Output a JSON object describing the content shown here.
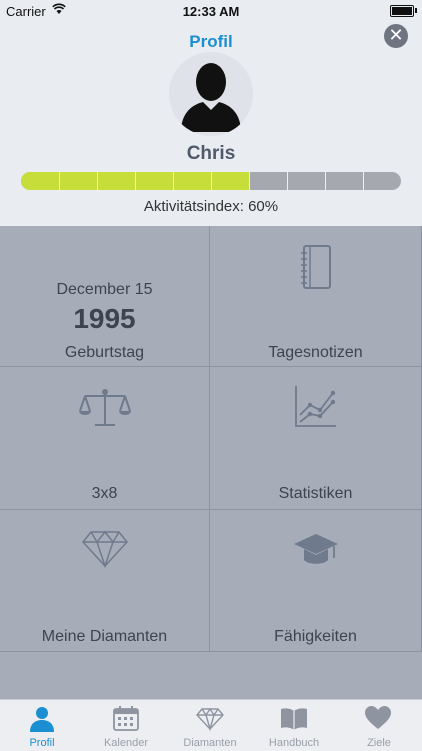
{
  "status_bar": {
    "carrier": "Carrier",
    "time": "12:33 AM"
  },
  "header": {
    "title": "Profil",
    "close_glyph": "✕",
    "name": "Chris",
    "activity_label": "Aktivitätsindex: 60%",
    "activity_fraction": 0.6,
    "progress_segments": 10,
    "colors": {
      "accent": "#1b8fd1",
      "progress_fill": "#c7dd3a",
      "progress_empty": "#a5a8ae"
    }
  },
  "grid": {
    "birthday": {
      "date": "December 15",
      "year": "1995",
      "label": "Geburtstag"
    },
    "notes": {
      "label": "Tagesnotizen",
      "icon": "notebook-icon"
    },
    "balance": {
      "label": "3x8",
      "icon": "scales-icon"
    },
    "stats": {
      "label": "Statistiken",
      "icon": "chart-icon"
    },
    "diamonds": {
      "label": "Meine Diamanten",
      "icon": "diamond-icon"
    },
    "skills": {
      "label": "Fähigkeiten",
      "icon": "graduation-cap-icon"
    }
  },
  "tabbar": {
    "tabs": [
      {
        "label": "Profil",
        "icon": "person-icon",
        "active": true
      },
      {
        "label": "Kalender",
        "icon": "calendar-icon"
      },
      {
        "label": "Diamanten",
        "icon": "diamond-icon"
      },
      {
        "label": "Handbuch",
        "icon": "book-icon"
      },
      {
        "label": "Ziele",
        "icon": "heart-icon"
      }
    ]
  }
}
